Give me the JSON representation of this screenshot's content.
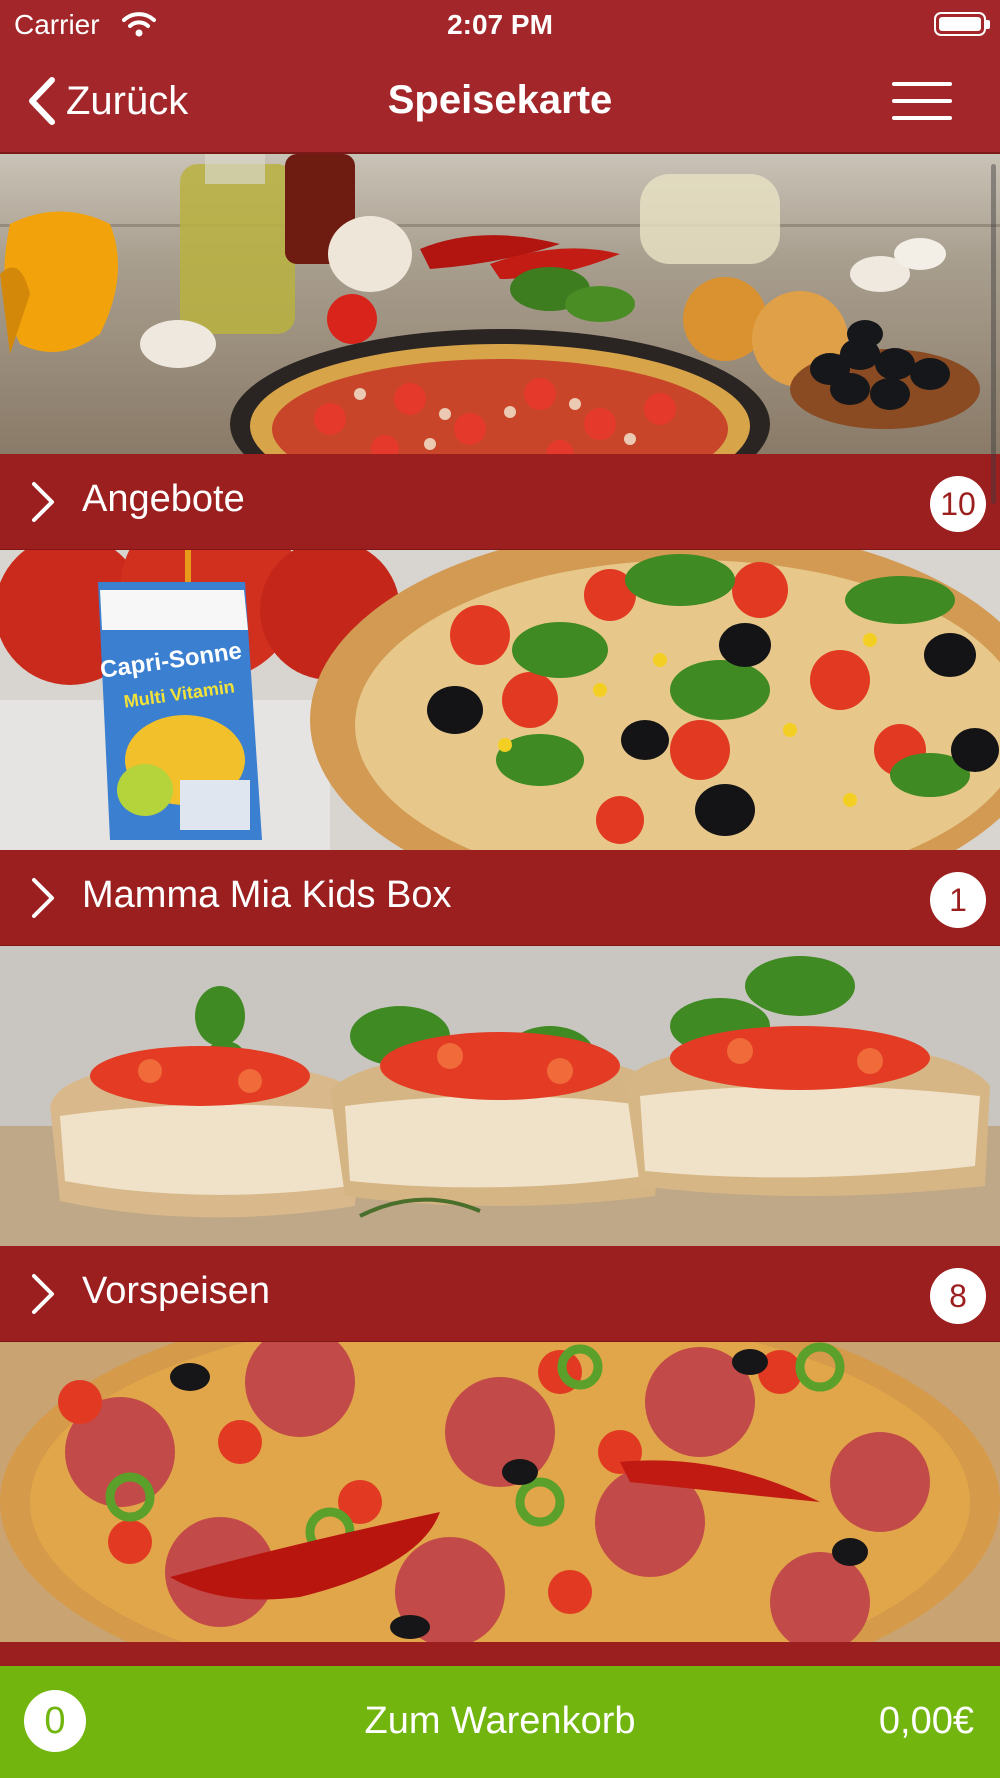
{
  "status_bar": {
    "carrier": "Carrier",
    "time": "2:07 PM"
  },
  "nav": {
    "back_label": "Zurück",
    "title": "Speisekarte"
  },
  "categories": [
    {
      "name": "Angebote",
      "count": "10"
    },
    {
      "name": "Mamma Mia Kids Box",
      "count": "1"
    },
    {
      "name": "Vorspeisen",
      "count": "8"
    },
    {
      "name": "",
      "count": ""
    }
  ],
  "kids_box_image": {
    "brand": "Capri-Sonne",
    "product": "Multi Vitamin"
  },
  "cart": {
    "count": "0",
    "label": "Zum Warenkorb",
    "total": "0,00€"
  },
  "colors": {
    "header": "#a3272a",
    "category_bar": "#9c1f1f",
    "cart_bar": "#71b50e"
  }
}
